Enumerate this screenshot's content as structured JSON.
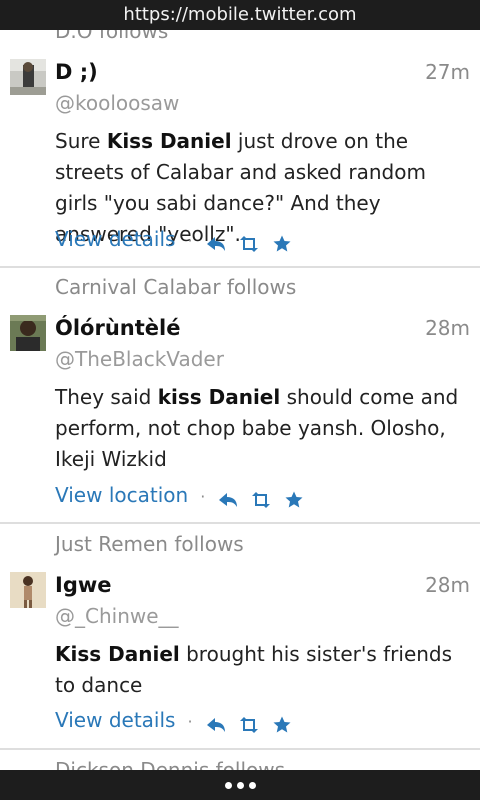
{
  "browser": {
    "url": "https://mobile.twitter.com"
  },
  "feed": {
    "top_partial_context": "D.O follows",
    "bottom_partial_context": "Dickson Dennis follows",
    "tweets": [
      {
        "context": "",
        "author": "D ;)",
        "handle": "@kooloosaw",
        "time": "27m",
        "text_parts": [
          "Sure ",
          "Kiss Daniel",
          " just drove on the streets of Calabar and asked random girls \"you sabi dance?\" And they answered \"yeollz\"."
        ],
        "link": "View details"
      },
      {
        "context": "Carnival Calabar follows",
        "author": "Ólórùntèlé",
        "handle": "@TheBlackVader",
        "time": "28m",
        "text_parts": [
          "They said ",
          "kiss Daniel",
          " should come and perform, not chop babe yansh. Olosho, Ikeji Wizkid"
        ],
        "link": "View location"
      },
      {
        "context": "Just Remen follows",
        "author": "Igwe",
        "handle": "@_Chinwe__",
        "time": "28m",
        "text_parts": [
          "",
          "Kiss Daniel",
          " brought his sister's friends to dance"
        ],
        "link": "View details"
      }
    ]
  },
  "icons": {
    "reply": "reply-icon",
    "retweet": "retweet-icon",
    "favorite": "star-icon",
    "more": "more-dots-icon"
  },
  "colors": {
    "link": "#2a78b8",
    "bar": "#1d1d1d",
    "muted": "#8a8a8a"
  }
}
